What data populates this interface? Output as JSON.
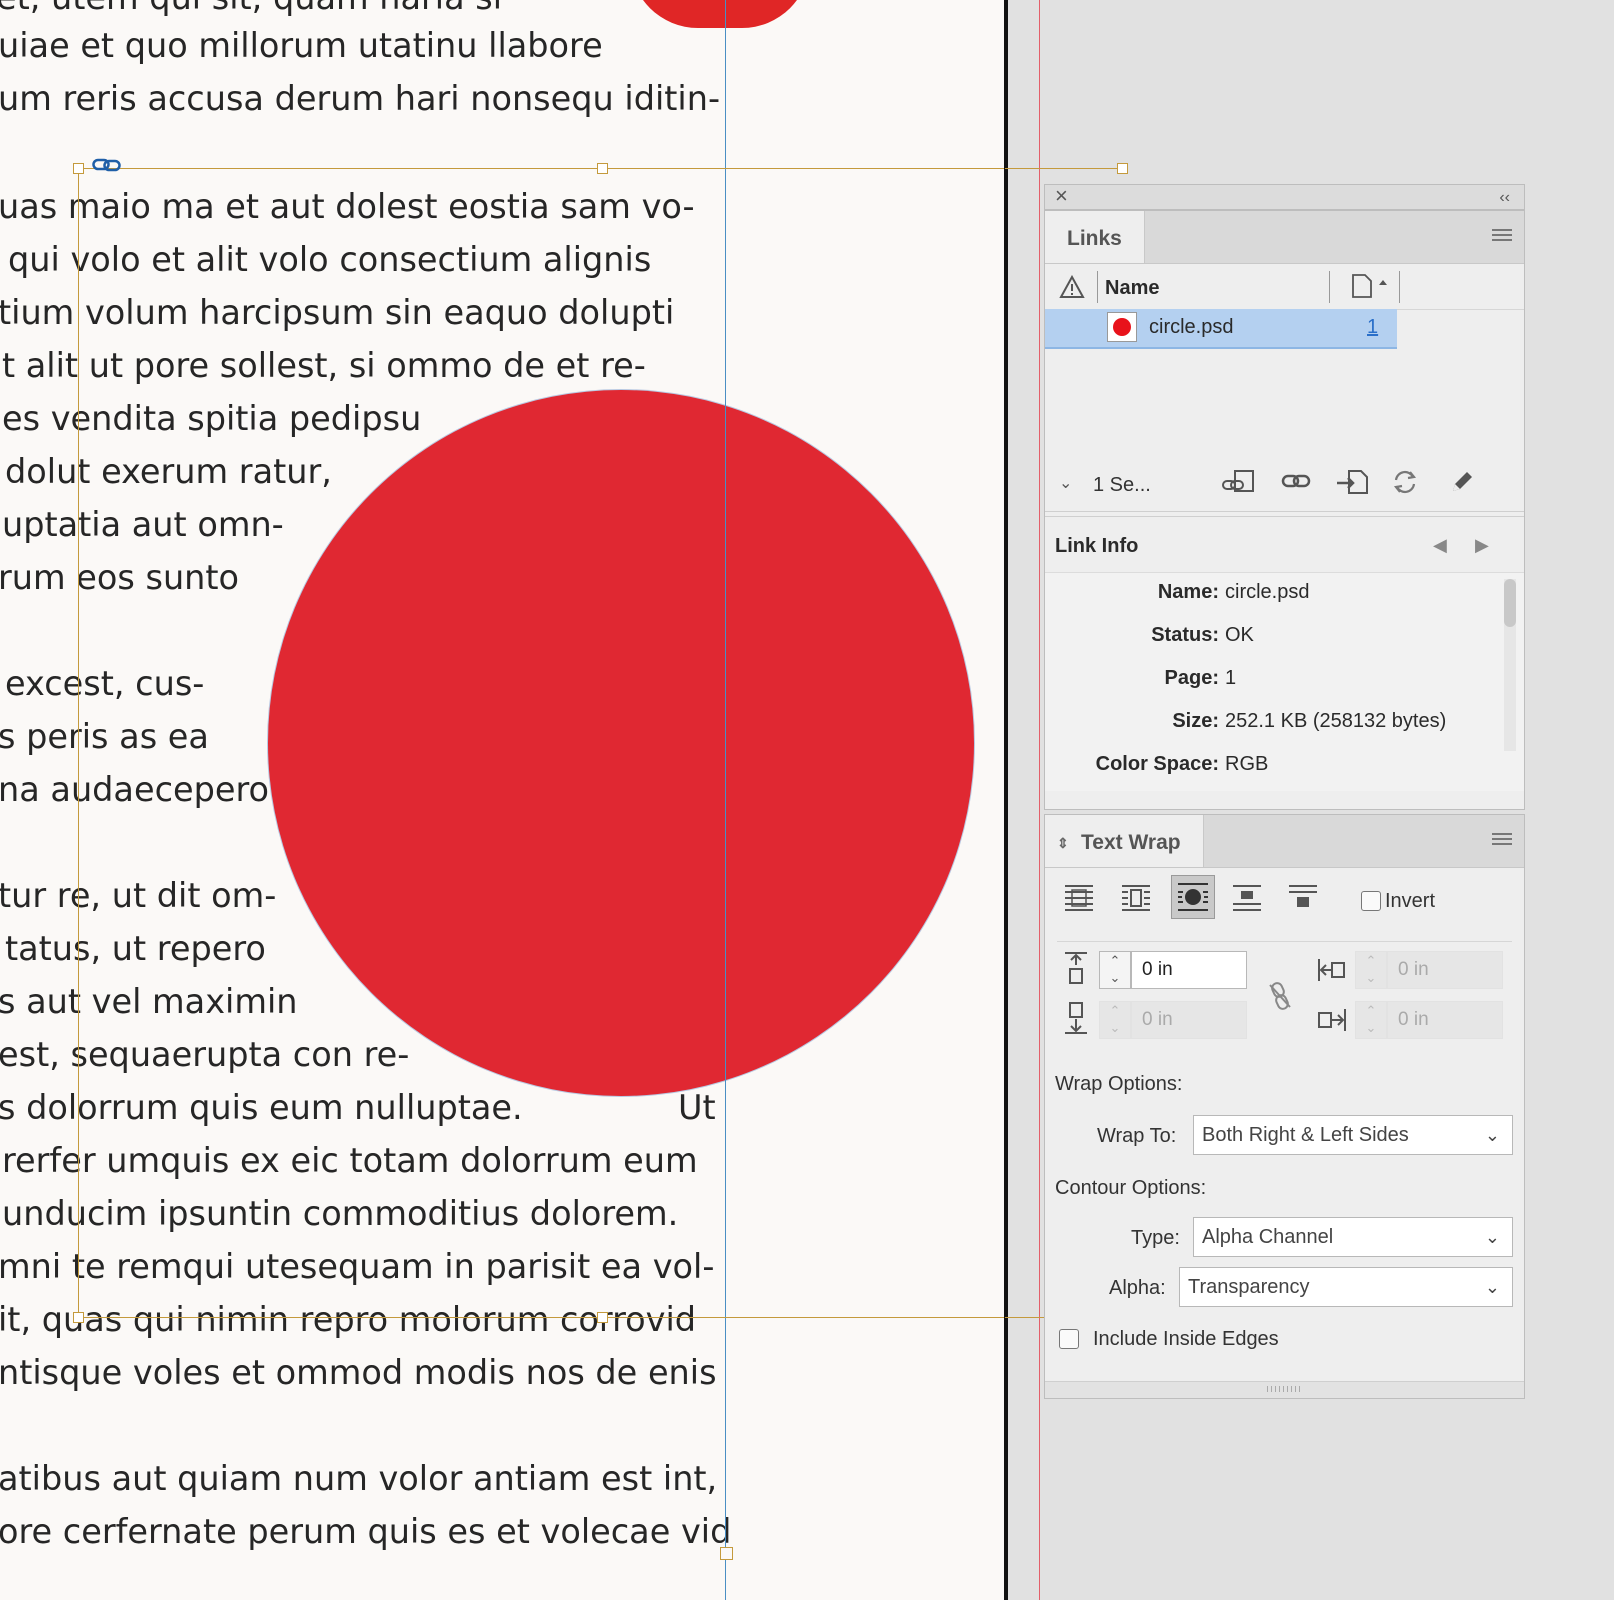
{
  "document": {
    "body_lines": [
      "et, utem qui sit, quam haria si",
      "uiae et quo millorum utatinu llabore",
      "um reris accusa derum hari nonsequ iditin-",
      "uas maio ma et aut dolest eostia sam vo-",
      "qui volo et alit volo consectium alignis",
      "tium volum harcipsum sin eaquo dolupti",
      "t alit ut pore sollest, si ommo de et re-",
      "es vendita spitia pedipsu",
      "dolut exerum ratur,",
      "uptatia aut omn-",
      "rum eos sunto",
      "excest, cus-",
      "s peris as ea",
      "na audaecepero",
      "tur re, ut dit om-",
      "tatus, ut repero",
      "s aut vel maximin",
      "est, sequaerupta con re-",
      "s dolorrum quis eum nulluptae.",
      "Ut",
      "rerfer umquis ex eic totam dolorrum eum",
      "unducim ipsuntin commoditius dolorem.",
      "mni te remqui utesequam in parisit ea vol-",
      "it, quas qui nimin repro molorum corrovid",
      "ntisque voles et ommod modis nos de enis",
      "atibus aut quiam num volor antiam est int,",
      "ore cerfernate perum quis es et volecae vid"
    ],
    "circle_color": "#e02832"
  },
  "panel_header": {
    "close_label": "×",
    "collapse_label": "‹‹"
  },
  "links": {
    "tab_label": "Links",
    "col_name": "Name",
    "file_name": "circle.psd",
    "page_number": "1",
    "selection_status": "1 Se...",
    "swatch_color": "#e8121b",
    "highlight_color": "#b4d0f0"
  },
  "link_info": {
    "title": "Link Info",
    "rows": [
      {
        "label": "Name:",
        "value": "circle.psd"
      },
      {
        "label": "Status:",
        "value": "OK"
      },
      {
        "label": "Page:",
        "value": "1"
      },
      {
        "label": "Size:",
        "value": "252.1 KB (258132 bytes)"
      },
      {
        "label": "Color Space:",
        "value": "RGB"
      }
    ]
  },
  "text_wrap": {
    "tab_label": "Text Wrap",
    "invert_label": "Invert",
    "top_offset": "0 in",
    "bottom_offset": "0 in",
    "left_offset": "0 in",
    "right_offset": "0 in",
    "wrap_options_label": "Wrap Options:",
    "wrap_to_label": "Wrap To:",
    "wrap_to_value": "Both Right & Left Sides",
    "contour_options_label": "Contour Options:",
    "type_label": "Type:",
    "type_value": "Alpha Channel",
    "alpha_label": "Alpha:",
    "alpha_value": "Transparency",
    "include_inside_edges_label": "Include Inside Edges"
  }
}
